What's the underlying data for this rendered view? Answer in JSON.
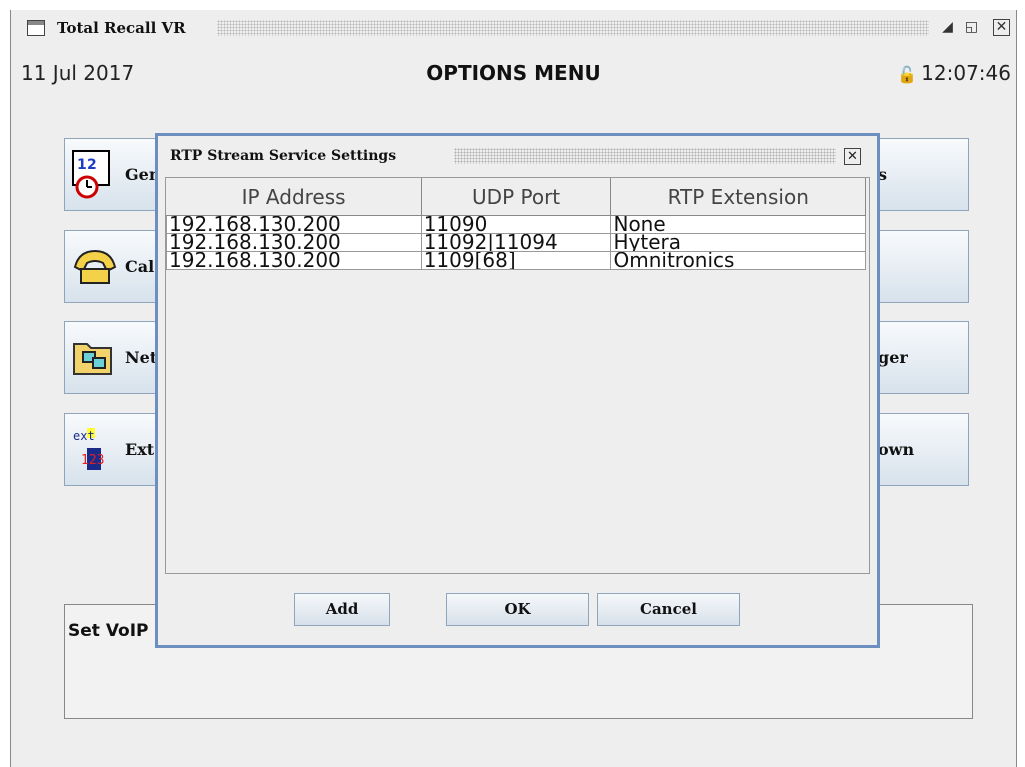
{
  "window": {
    "title": "Total Recall VR",
    "controls": {
      "minimize_icon": "minimize-icon",
      "maximize_icon": "maximize-icon",
      "close_icon": "close-icon"
    }
  },
  "header": {
    "date": "11 Jul 2017",
    "title": "OPTIONS MENU",
    "time": "12:07:46",
    "lock_icon": "lock-icon"
  },
  "menu_buttons": {
    "general": "Gen",
    "calls": "Cal",
    "network": "Net",
    "extensions": "Ext",
    "right_1": "s",
    "right_3": "ger",
    "right_4": "own"
  },
  "voip_box": {
    "label": "Set VoIP"
  },
  "dialog": {
    "title": "RTP Stream Service Settings",
    "columns": [
      "IP Address",
      "UDP Port",
      "RTP Extension"
    ],
    "rows": [
      [
        "192.168.130.200",
        "11090",
        "None"
      ],
      [
        "192.168.130.200",
        "11092|11094",
        "Hytera"
      ],
      [
        "192.168.130.200",
        "1109[68]",
        "Omnitronics"
      ]
    ],
    "buttons": {
      "add": "Add",
      "ok": "OK",
      "cancel": "Cancel"
    }
  }
}
